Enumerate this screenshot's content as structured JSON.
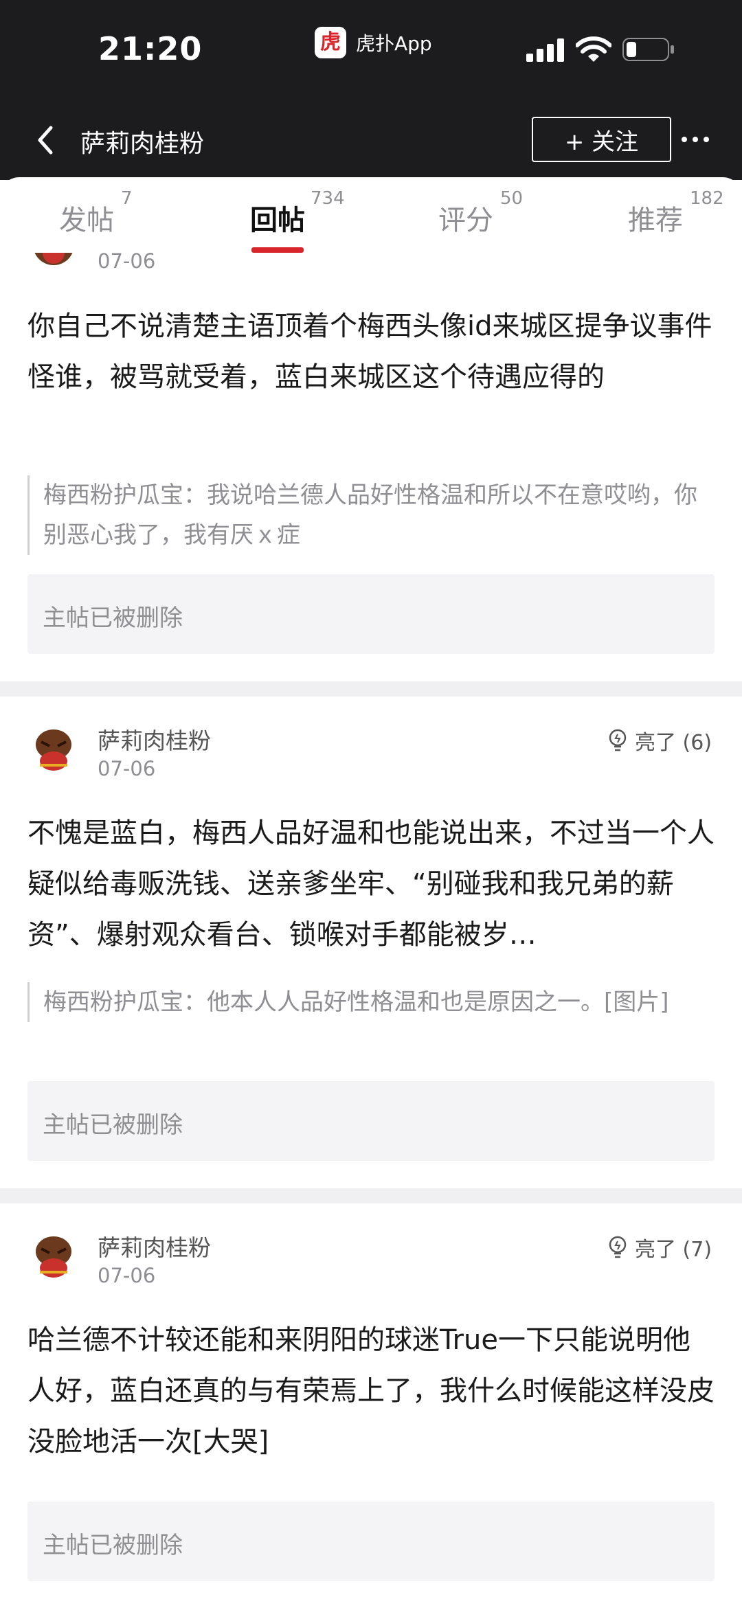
{
  "status_bar": {
    "time": "21:20",
    "app_name": "虎扑App",
    "app_logo_char": "虎"
  },
  "header": {
    "title": "萨莉肉桂粉",
    "follow_label": "+ 关注"
  },
  "tabs": [
    {
      "label": "发帖",
      "count": "7",
      "active": false
    },
    {
      "label": "回帖",
      "count": "734",
      "active": true
    },
    {
      "label": "评分",
      "count": "50",
      "active": false
    },
    {
      "label": "推荐",
      "count": "182",
      "active": false
    }
  ],
  "colors": {
    "accent": "#d8252b",
    "header_bg": "#1c1c1e"
  },
  "posts": [
    {
      "date": "07-06",
      "text": "你自己不说清楚主语顶着个梅西头像id来城区提争议事件怪谁，被骂就受着，蓝白来城区这个待遇应得的",
      "quote": "梅西粉护瓜宝：我说哈兰德人品好性格温和所以不在意哎哟，你别恶心我了，我有厌ｘ症",
      "deleted": "主帖已被删除"
    },
    {
      "author": "萨莉肉桂粉",
      "date": "07-06",
      "likes": "亮了 (6)",
      "text": "不愧是蓝白，梅西人品好温和也能说出来，不过当一个人疑似给毒贩洗钱、送亲爹坐牢、“别碰我和我兄弟的薪资”、爆射观众看台、锁喉对手都能被岁…",
      "quote": "梅西粉护瓜宝：他本人人品好性格温和也是原因之一。[图片]",
      "deleted": "主帖已被删除"
    },
    {
      "author": "萨莉肉桂粉",
      "date": "07-06",
      "likes": "亮了 (7)",
      "text": "哈兰德不计较还能和来阴阳的球迷True一下只能说明他人好，蓝白还真的与有荣焉上了，我什么时候能这样没皮没脸地活一次[大哭]",
      "deleted": "主帖已被删除"
    }
  ]
}
